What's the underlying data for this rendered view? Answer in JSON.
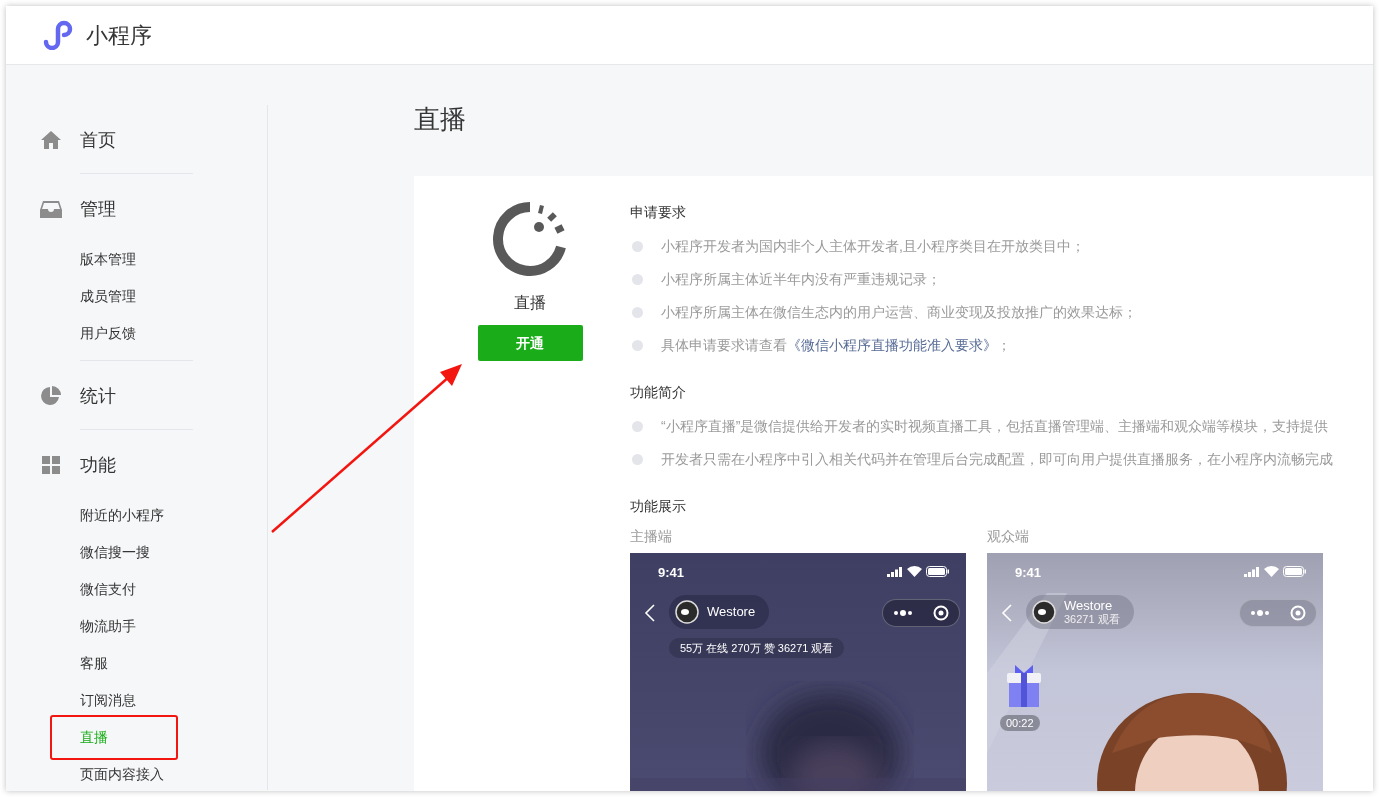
{
  "app": {
    "title": "小程序"
  },
  "sidebar": [
    {
      "label": "首页"
    },
    {
      "label": "管理",
      "children": [
        {
          "label": "版本管理",
          "selected": false,
          "boxed": false
        },
        {
          "label": "成员管理",
          "selected": false,
          "boxed": false
        },
        {
          "label": "用户反馈",
          "selected": false,
          "boxed": false
        }
      ]
    },
    {
      "label": "统计"
    },
    {
      "label": "功能",
      "children": [
        {
          "label": "附近的小程序",
          "selected": false,
          "boxed": false
        },
        {
          "label": "微信搜一搜",
          "selected": false,
          "boxed": false
        },
        {
          "label": "微信支付",
          "selected": false,
          "boxed": false
        },
        {
          "label": "物流助手",
          "selected": false,
          "boxed": false
        },
        {
          "label": "客服",
          "selected": false,
          "boxed": false
        },
        {
          "label": "订阅消息",
          "selected": false,
          "boxed": false
        },
        {
          "label": "直播",
          "selected": true,
          "boxed": true
        },
        {
          "label": "页面内容接入",
          "selected": false,
          "boxed": false
        }
      ]
    }
  ],
  "page_title": "直播",
  "feature": {
    "name": "直播",
    "button": "开通"
  },
  "sections": [
    {
      "heading": "申请要求",
      "items": [
        {
          "text": "小程序开发者为国内非个人主体开发者,且小程序类目在开放类目中；"
        },
        {
          "text": "小程序所属主体近半年内没有严重违规记录；"
        },
        {
          "text": "小程序所属主体在微信生态内的用户运营、商业变现及投放推广的效果达标；"
        },
        {
          "text": "具体申请要求请查看",
          "link": "《微信小程序直播功能准入要求》",
          "suffix": "；"
        }
      ]
    },
    {
      "heading": "功能简介",
      "items": [
        {
          "text": "“小程序直播”是微信提供给开发者的实时视频直播工具，包括直播管理端、主播端和观众端等模块，支持提供"
        },
        {
          "text": "开发者只需在小程序中引入相关代码并在管理后台完成配置，即可向用户提供直播服务，在小程序内流畅完成"
        }
      ]
    }
  ],
  "showcase": {
    "heading": "功能展示",
    "phones": [
      {
        "kind": "host",
        "caption": "主播端",
        "time": "9:41",
        "account": "Westore",
        "stats": "55万 在线 270万 赞 36271 观看"
      },
      {
        "kind": "viewer",
        "caption": "观众端",
        "time": "9:41",
        "account": "Westore",
        "subtitle": "36271 观看",
        "timer": "00:22"
      }
    ]
  },
  "annotations": {
    "arrow": true
  }
}
